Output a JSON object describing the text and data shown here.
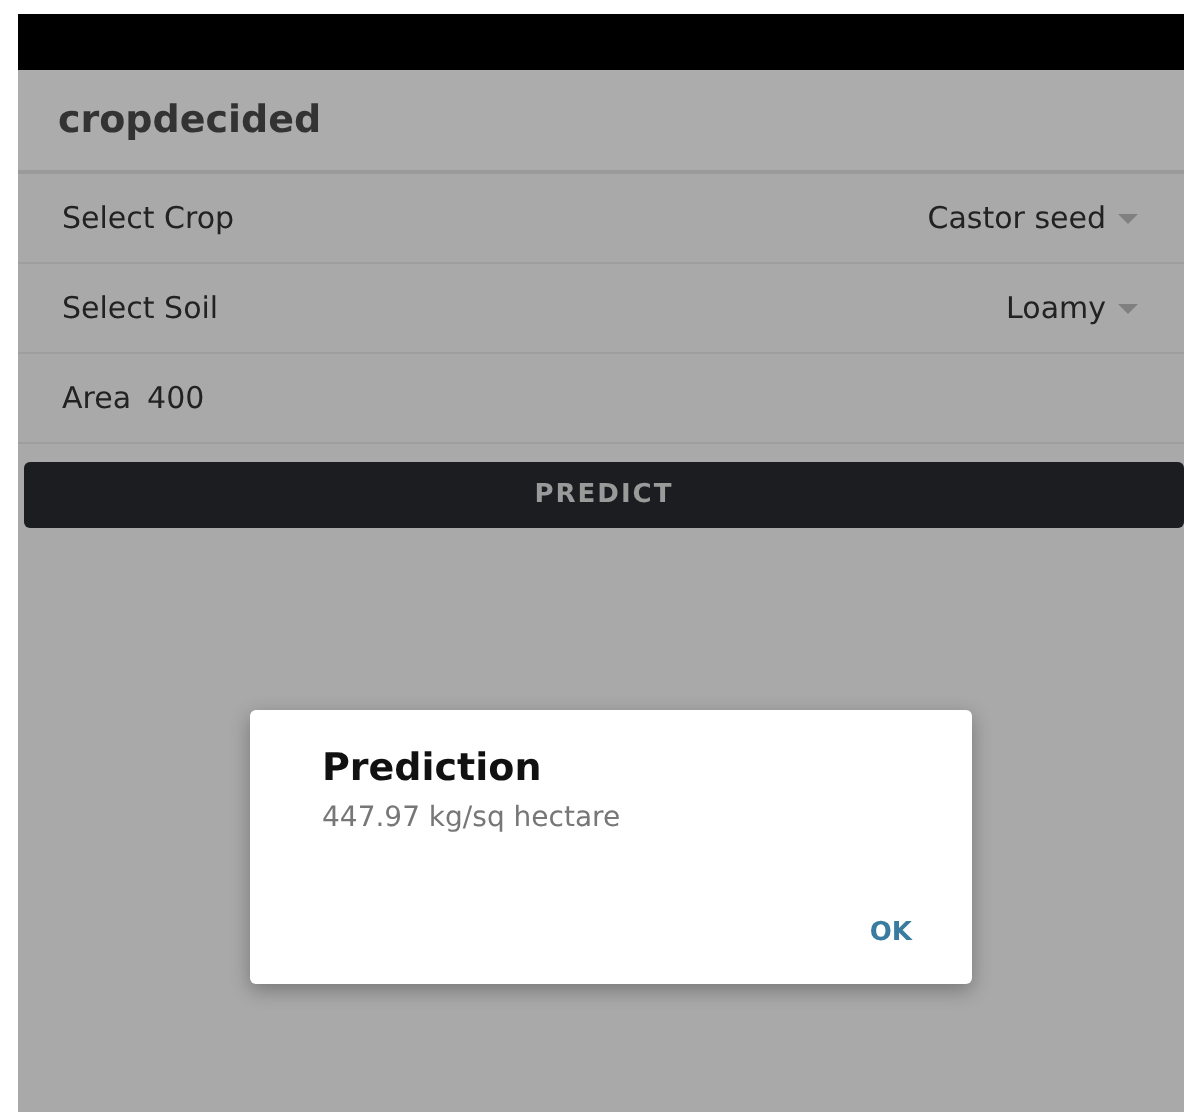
{
  "app_bar": {
    "title": "cropdecided"
  },
  "rows": [
    {
      "kind": "dropdown",
      "label": "Select Crop",
      "value": "Castor seed"
    },
    {
      "kind": "dropdown",
      "label": "Select Soil",
      "value": "Loamy"
    },
    {
      "kind": "field",
      "label": "Area",
      "value": "400"
    }
  ],
  "button": {
    "label": "PREDICT"
  },
  "dialog": {
    "title": "Prediction",
    "message": "447.97 kg/sq hectare",
    "action": "OK"
  }
}
